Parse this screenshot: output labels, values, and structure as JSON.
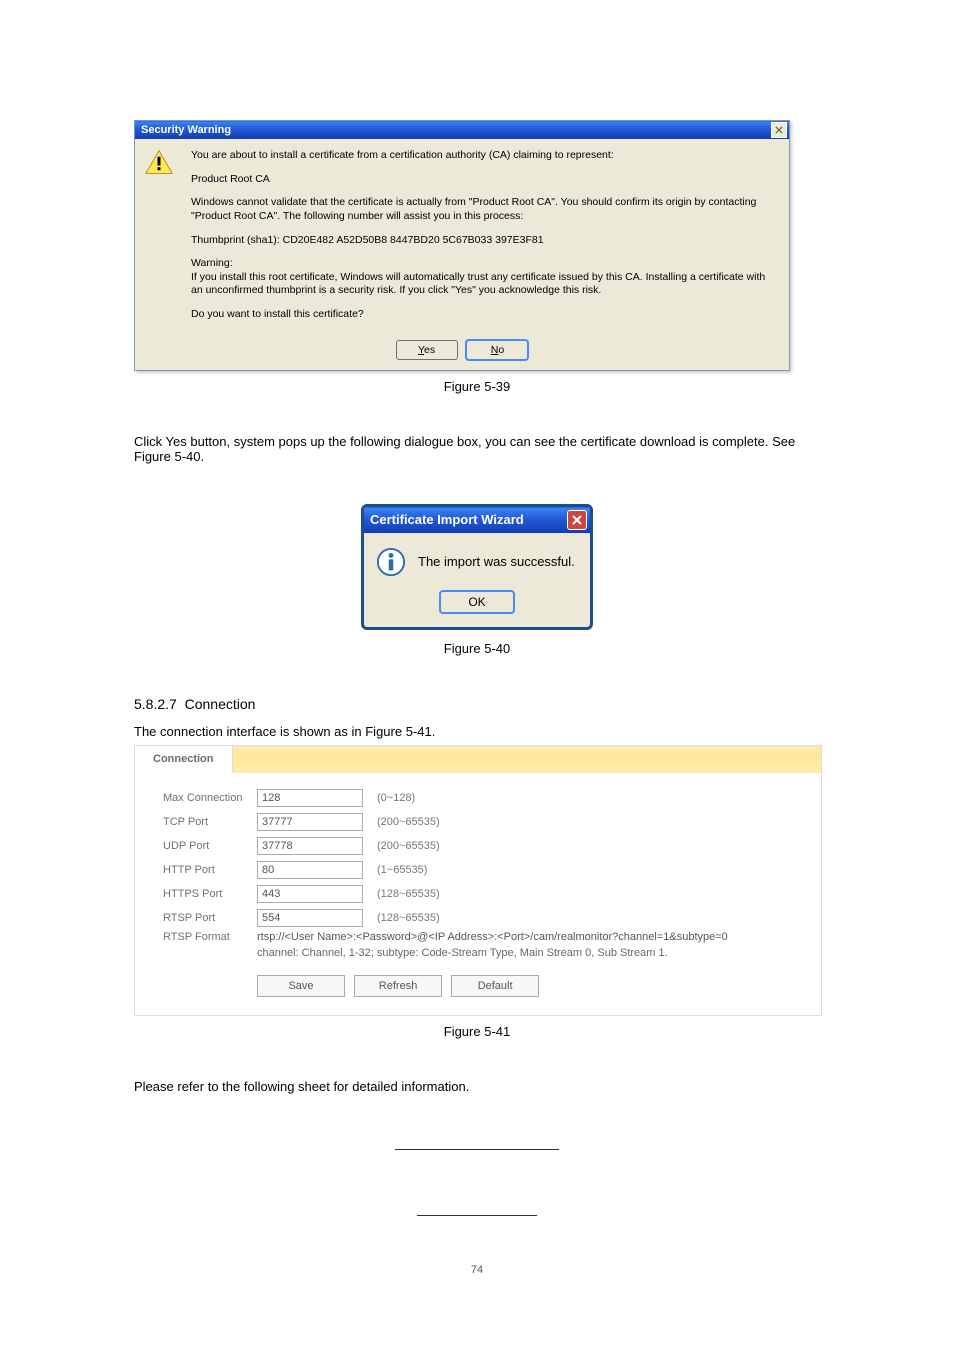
{
  "security_warning": {
    "title": "Security Warning",
    "line1": "You are about to install a certificate from a certification authority (CA) claiming to represent:",
    "ca_name": "Product Root CA",
    "line2": "Windows cannot validate that the certificate is actually from \"Product Root CA\". You should confirm its origin by contacting \"Product Root CA\". The following number will assist you in this process:",
    "thumbprint": "Thumbprint (sha1): CD20E482 A52D50B8 8447BD20 5C67B033 397E3F81",
    "warning_label": "Warning:",
    "warning_body": "If you install this root certificate, Windows will automatically trust any certificate issued by this CA. Installing a certificate with an unconfirmed thumbprint is a security risk. If you click \"Yes\" you acknowledge this risk.",
    "confirm_q": "Do you want to install this certificate?",
    "yes_label": "Yes",
    "no_label": "No"
  },
  "fig1_caption": "Figure 5-39",
  "complete_text": "Click Yes button, system pops up the following dialogue box, you can see the certificate download is complete. See Figure 5-40.",
  "import_ok": {
    "title": "Certificate Import Wizard",
    "message": "The import was successful.",
    "ok_label": "OK"
  },
  "fig2_caption": "Figure 5-40",
  "section_no": "5.8.2.7",
  "section_title": "Connection",
  "section_intro": "The connection interface is shown as in Figure 5-41.",
  "connection": {
    "tab": "Connection",
    "rows": {
      "max_conn": {
        "label": "Max Connection",
        "value": "128",
        "range": "(0~128)"
      },
      "tcp": {
        "label": "TCP Port",
        "value": "37777",
        "range": "(200~65535)"
      },
      "udp": {
        "label": "UDP Port",
        "value": "37778",
        "range": "(200~65535)"
      },
      "http": {
        "label": "HTTP Port",
        "value": "80",
        "range": "(1~65535)"
      },
      "https": {
        "label": "HTTPS Port",
        "value": "443",
        "range": "(128~65535)"
      },
      "rtsp": {
        "label": "RTSP Port",
        "value": "554",
        "range": "(128~65535)"
      }
    },
    "rtsp_format_label": "RTSP Format",
    "rtsp_format_line1": "rtsp://<User Name>:<Password>@<IP Address>:<Port>/cam/realmonitor?channel=1&subtype=0",
    "rtsp_format_line2": "channel: Channel, 1-32; subtype: Code-Stream Type, Main Stream 0, Sub Stream 1.",
    "buttons": {
      "save": "Save",
      "refresh": "Refresh",
      "default": "Default"
    }
  },
  "fig3_caption": "Figure 5-41",
  "table_intro": "Please refer to the following sheet for detailed information.",
  "bottom_page_number": "74"
}
